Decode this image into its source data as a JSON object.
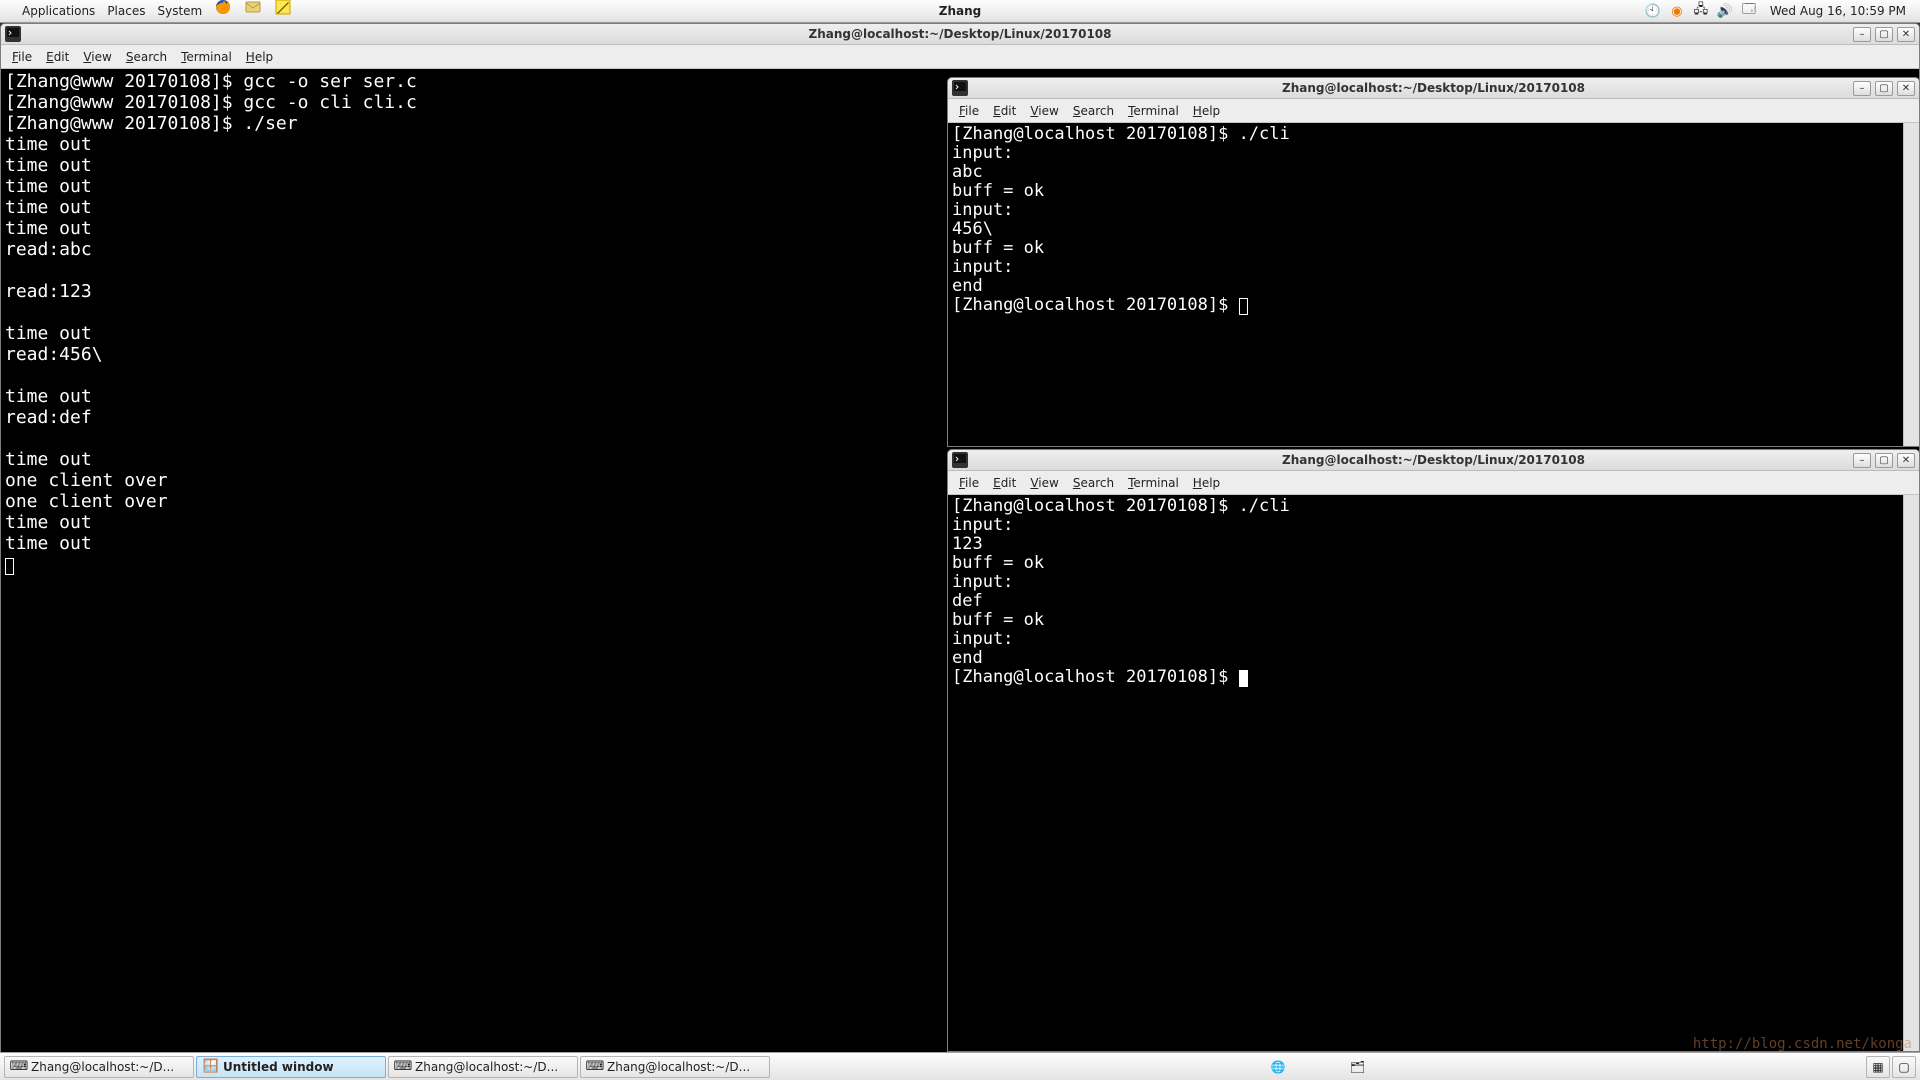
{
  "top": {
    "menus": [
      "Applications",
      "Places",
      "System"
    ],
    "title": "Zhang",
    "clock": "Wed Aug 16, 10:59 PM"
  },
  "menubar": {
    "file": "File",
    "edit": "Edit",
    "view": "View",
    "search": "Search",
    "terminal": "Terminal",
    "help": "Help"
  },
  "win1": {
    "title": "Zhang@localhost:~/Desktop/Linux/20170108",
    "lines": [
      "[Zhang@www 20170108]$ gcc -o ser ser.c",
      "[Zhang@www 20170108]$ gcc -o cli cli.c",
      "[Zhang@www 20170108]$ ./ser",
      "time out",
      "time out",
      "time out",
      "time out",
      "time out",
      "read:abc",
      "",
      "read:123",
      "",
      "time out",
      "read:456\\",
      "",
      "time out",
      "read:def",
      "",
      "time out",
      "one client over",
      "one client over",
      "time out",
      "time out"
    ]
  },
  "win2": {
    "title": "Zhang@localhost:~/Desktop/Linux/20170108",
    "lines": [
      "[Zhang@localhost 20170108]$ ./cli",
      "input:",
      "abc",
      "buff = ok",
      "input:",
      "456\\",
      "buff = ok",
      "input:",
      "end",
      "[Zhang@localhost 20170108]$ "
    ]
  },
  "win3": {
    "title": "Zhang@localhost:~/Desktop/Linux/20170108",
    "lines": [
      "[Zhang@localhost 20170108]$ ./cli",
      "input:",
      "123",
      "buff = ok",
      "input:",
      "def",
      "buff = ok",
      "input:",
      "end",
      "[Zhang@localhost 20170108]$ "
    ]
  },
  "tasks": [
    {
      "label": "Zhang@localhost:~/D...",
      "icon": "term",
      "active": false
    },
    {
      "label": "Untitled window",
      "icon": "draw",
      "active": true
    },
    {
      "label": "Zhang@localhost:~/D...",
      "icon": "term",
      "active": false
    },
    {
      "label": "Zhang@localhost:~/D...",
      "icon": "term",
      "active": false
    }
  ],
  "watermark": "http://blog.csdn.net/konga",
  "icons": {
    "globe": "🌐",
    "files": "🗂",
    "pager1": "▭",
    "pager2": "▭"
  }
}
